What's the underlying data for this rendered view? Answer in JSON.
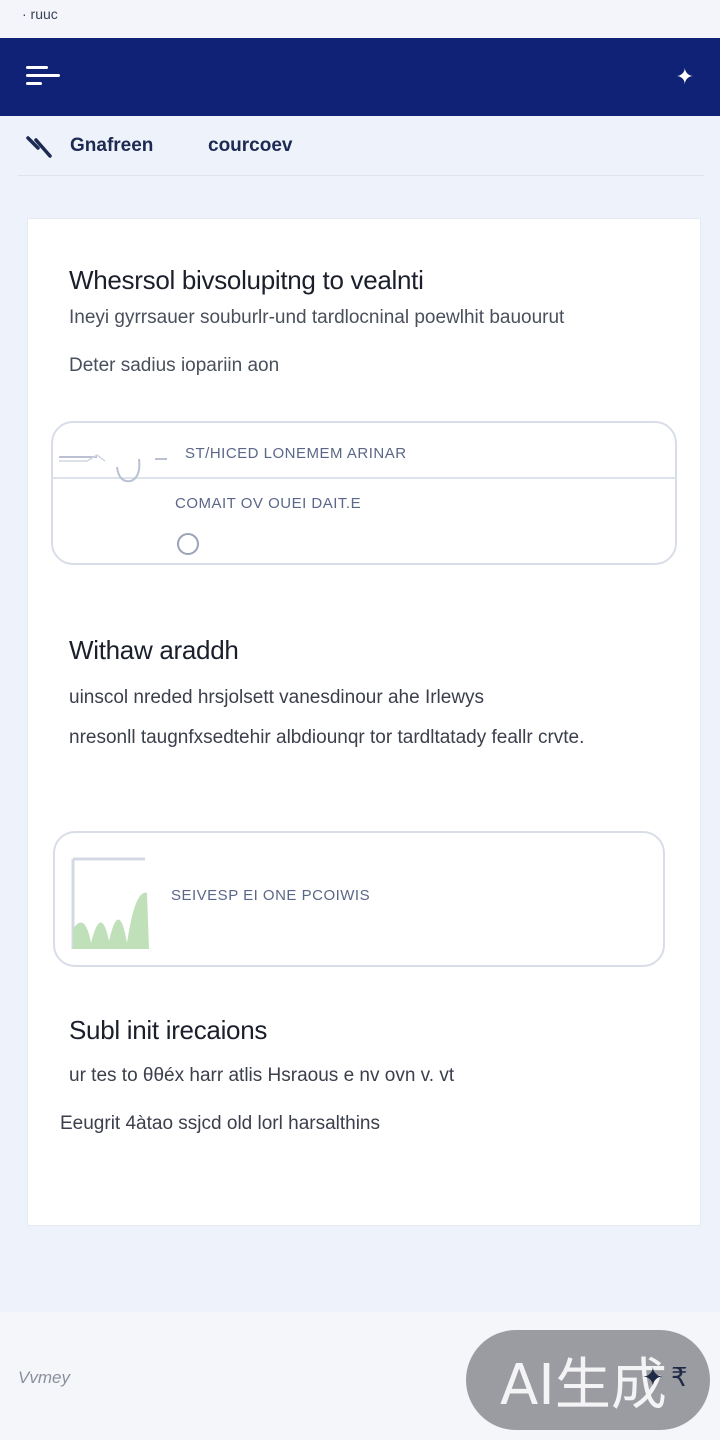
{
  "status_bar": {
    "text": "· ruuc"
  },
  "app_bar": {
    "menu_icon": "menu-icon",
    "action_icon": "sparkle-icon"
  },
  "breadcrumb": {
    "first": "Gnafreen",
    "second": "courcoev"
  },
  "section1": {
    "title": "Whesrsol bivsolupitng to vealnti",
    "line1": "Ineyi gyrrsauer souburlr-und tardlocninal poewlhit bauourut",
    "line2": "Deter sadius iopariin aon",
    "box": {
      "heading": "ST/HICED LONEMEM ARINAR",
      "sub": "COMAIT  OV OUEI DAIT.E"
    }
  },
  "section2": {
    "title": "Withaw araddh",
    "line1": "uinscol nreded hrsjolsett vanesdinour    ahe  Irlewys",
    "line2": "nresonll taugnfxsedtehir albdiounqr tor tardltatady feallr crvte.",
    "box": {
      "label": "SEIVESP EI  ONE  PCOIWIS"
    }
  },
  "section3": {
    "title": "Subl init irecaions",
    "line1": "ur tes to θθéx harr atlis Hsraous e   nv ovn  v. vt",
    "line2": "Eeugrit 4àtao ssjcd old lorl harsalthins"
  },
  "footer": {
    "logo_text": "Vvmey",
    "badge_text": "AI生成",
    "icons": "✦ ₹"
  },
  "colors": {
    "app_bar": "#0f2275",
    "accent": "#1d2a52",
    "chart_fill": "#bfe0b8"
  }
}
